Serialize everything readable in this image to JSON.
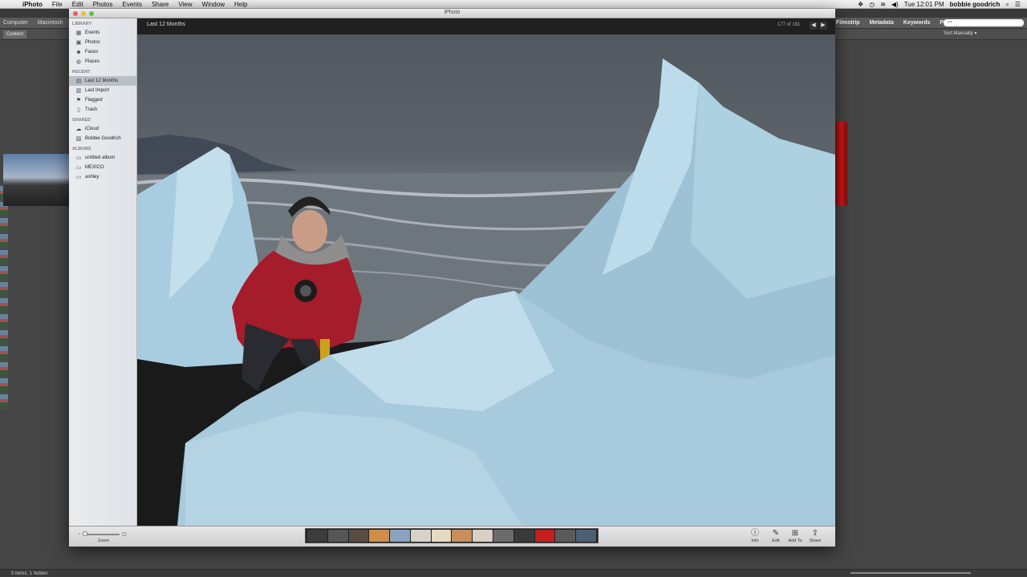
{
  "menubar": {
    "items": [
      "iPhoto",
      "File",
      "Edit",
      "Photos",
      "Events",
      "Share",
      "View",
      "Window",
      "Help"
    ],
    "clock": "Tue 12:01 PM",
    "user": "bobbie goodrich"
  },
  "background_app": {
    "crumbs": [
      "Computer",
      "Macintosh"
    ],
    "panel_tabs": [
      "Filmstrip",
      "Metadata",
      "Keywords",
      "Prev"
    ],
    "search_placeholder": "⌕▾",
    "content_tab": "Content",
    "sort": "Sort Manually ▾",
    "status": "5 items, 1 hidden"
  },
  "window": {
    "title": "iPhoto"
  },
  "sidebar": {
    "sections": [
      {
        "title": "LIBRARY",
        "items": [
          {
            "label": "Events",
            "icon": "events-icon"
          },
          {
            "label": "Photos",
            "icon": "photos-icon"
          },
          {
            "label": "Faces",
            "icon": "faces-icon"
          },
          {
            "label": "Places",
            "icon": "places-icon"
          }
        ]
      },
      {
        "title": "RECENT",
        "items": [
          {
            "label": "Last 12 Months",
            "icon": "calendar-icon",
            "selected": true
          },
          {
            "label": "Last Import",
            "icon": "import-icon"
          },
          {
            "label": "Flagged",
            "icon": "flag-icon"
          },
          {
            "label": "Trash",
            "icon": "trash-icon"
          }
        ]
      },
      {
        "title": "SHARED",
        "items": [
          {
            "label": "iCloud",
            "icon": "cloud-icon"
          },
          {
            "label": "Bobbie Goodrich",
            "icon": "shared-stream-icon"
          }
        ]
      },
      {
        "title": "ALBUMS",
        "items": [
          {
            "label": "untitled album",
            "icon": "album-icon"
          },
          {
            "label": "MEXICO",
            "icon": "album-icon"
          },
          {
            "label": "ashley",
            "icon": "album-icon"
          }
        ]
      }
    ]
  },
  "viewer": {
    "album": "Last 12 Months",
    "counter": "177 of 191",
    "prev": "◀",
    "next": "▶"
  },
  "bottombar": {
    "zoom_label": "Zoom",
    "tools": [
      {
        "label": "Info",
        "icon": "info-icon",
        "glyph": "ⓘ"
      },
      {
        "label": "Edit",
        "icon": "pencil-icon",
        "glyph": "✎"
      },
      {
        "label": "Add To",
        "icon": "add-icon",
        "glyph": "⊞"
      },
      {
        "label": "Share",
        "icon": "share-icon",
        "glyph": "⇪"
      }
    ],
    "filmstrip_colors": [
      "#3c3c3c",
      "#565656",
      "#5b4c42",
      "#cf8d4a",
      "#8aa2bd",
      "#d7d2c8",
      "#e8dac0",
      "#c88f5c",
      "#d9cfc2",
      "#6b6b6b",
      "#3a3a3a",
      "#c21f1f",
      "#5a5a5a",
      "#4d5f73"
    ]
  }
}
